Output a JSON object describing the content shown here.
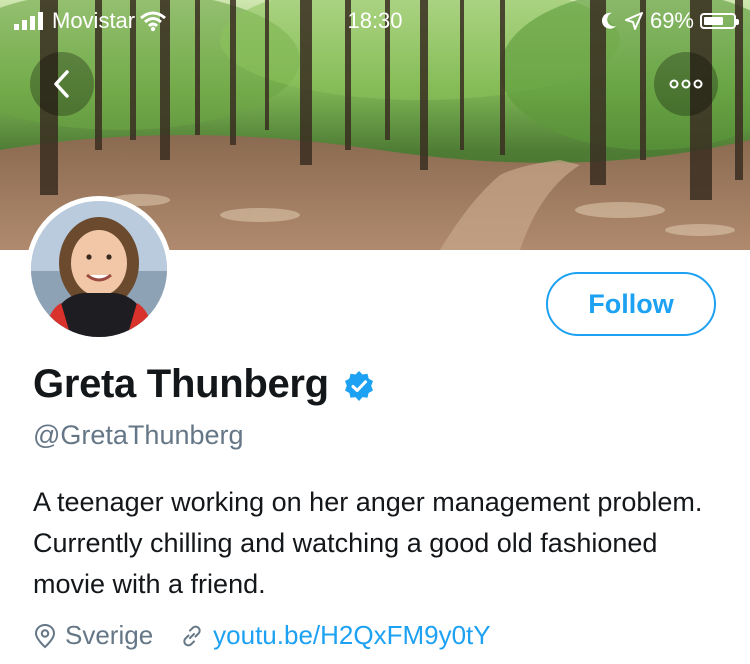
{
  "status_bar": {
    "carrier": "Movistar",
    "time": "18:30",
    "battery": "69%",
    "battery_level": 0.69
  },
  "header": {
    "back_icon": "chevron-left-icon",
    "more_icon": "more-horizontal-icon"
  },
  "profile": {
    "display_name": "Greta Thunberg",
    "handle": "@GretaThunberg",
    "verified": true,
    "bio": "A teenager working on her anger management problem. Currently chilling and watching a good old fashioned movie with a friend.",
    "location": "Sverige",
    "website": "youtu.be/H2QxFM9y0tY",
    "follow_label": "Follow"
  },
  "colors": {
    "accent": "#1da1f2",
    "secondary_text": "#657786",
    "primary_text": "#14171a"
  }
}
